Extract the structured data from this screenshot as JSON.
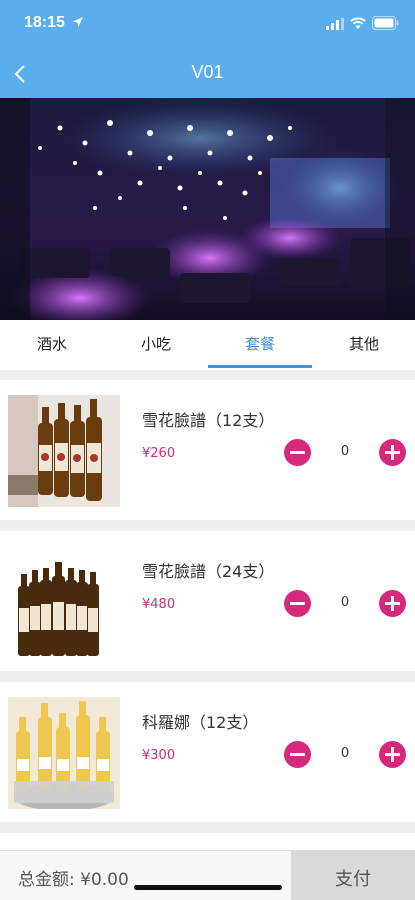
{
  "status_bar": {
    "time": "18:15"
  },
  "header": {
    "title": "V01",
    "back_icon": "chevron-left-icon"
  },
  "tabs": [
    {
      "label": "酒水",
      "active": false
    },
    {
      "label": "小吃",
      "active": false
    },
    {
      "label": "套餐",
      "active": true
    },
    {
      "label": "其他",
      "active": false
    }
  ],
  "products": [
    {
      "name": "雪花臉譜（12支）",
      "price": "¥260",
      "qty": "0"
    },
    {
      "name": "雪花臉譜（24支）",
      "price": "¥480",
      "qty": "0"
    },
    {
      "name": "科羅娜（12支）",
      "price": "¥300",
      "qty": "0"
    }
  ],
  "footer": {
    "total_label": "总金额: ¥0.00",
    "pay_label": "支付"
  },
  "colors": {
    "header_bg": "#5aaeeb",
    "accent": "#d6287c",
    "tab_active": "#4a90d9"
  }
}
